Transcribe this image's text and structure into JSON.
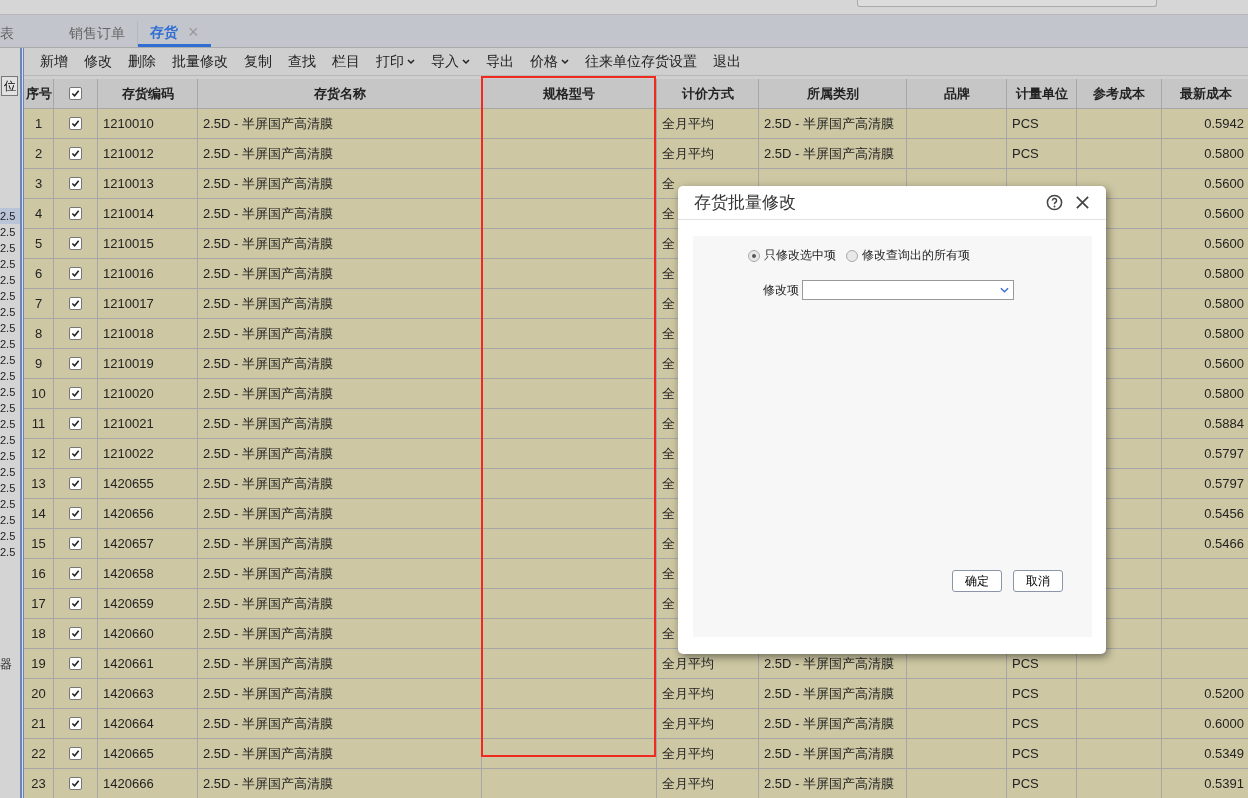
{
  "tabs": [
    {
      "label": "表",
      "selected": false,
      "closable": false
    },
    {
      "label": "销售订单",
      "selected": false,
      "closable": false
    },
    {
      "label": "存货",
      "selected": true,
      "closable": true
    }
  ],
  "close_glyph": "×",
  "left_panel": {
    "button": "位",
    "items": [
      {
        "label": "2.5",
        "selected": true
      },
      {
        "label": "2.5",
        "selected": false
      },
      {
        "label": "2.5",
        "selected": false
      },
      {
        "label": "2.5",
        "selected": false
      },
      {
        "label": "2.5",
        "selected": false
      },
      {
        "label": "2.5",
        "selected": false
      },
      {
        "label": "2.5",
        "selected": false
      },
      {
        "label": "2.5",
        "selected": false
      },
      {
        "label": "2.5",
        "selected": false
      },
      {
        "label": "2.5",
        "selected": false
      },
      {
        "label": "2.5",
        "selected": false
      },
      {
        "label": "2.5",
        "selected": false
      },
      {
        "label": "2.5",
        "selected": false
      },
      {
        "label": "2.5",
        "selected": false
      },
      {
        "label": "2.5",
        "selected": false
      },
      {
        "label": "2.5",
        "selected": false
      },
      {
        "label": "2.5",
        "selected": false
      },
      {
        "label": "2.5",
        "selected": false
      },
      {
        "label": "2.5",
        "selected": false
      },
      {
        "label": "2.5",
        "selected": false
      },
      {
        "label": "2.5",
        "selected": false
      },
      {
        "label": "2.5",
        "selected": false
      }
    ],
    "footer": "器"
  },
  "toolbar": [
    {
      "label": "新增",
      "dropdown": false
    },
    {
      "label": "修改",
      "dropdown": false
    },
    {
      "label": "删除",
      "dropdown": false
    },
    {
      "label": "批量修改",
      "dropdown": false
    },
    {
      "label": "复制",
      "dropdown": false
    },
    {
      "label": "查找",
      "dropdown": false
    },
    {
      "label": "栏目",
      "dropdown": false
    },
    {
      "label": "打印",
      "dropdown": true
    },
    {
      "label": "导入",
      "dropdown": true
    },
    {
      "label": "导出",
      "dropdown": false
    },
    {
      "label": "价格",
      "dropdown": true
    },
    {
      "label": "往来单位存货设置",
      "dropdown": false
    },
    {
      "label": "退出",
      "dropdown": false
    }
  ],
  "table": {
    "columns": [
      "序号",
      "存货编码",
      "存货名称",
      "规格型号",
      "计价方式",
      "所属类别",
      "品牌",
      "计量单位",
      "参考成本",
      "最新成本"
    ],
    "header_checked": true,
    "rows": [
      {
        "no": "1",
        "checked": true,
        "code": "1210010",
        "name": "2.5D - 半屏国产高清膜",
        "pricing": "全月平均",
        "category": "2.5D - 半屏国产高清膜",
        "unit": "PCS",
        "latest": "0.5942"
      },
      {
        "no": "2",
        "checked": true,
        "code": "1210012",
        "name": "2.5D - 半屏国产高清膜",
        "pricing": "全月平均",
        "category": "2.5D - 半屏国产高清膜",
        "unit": "PCS",
        "latest": "0.5800"
      },
      {
        "no": "3",
        "checked": true,
        "code": "1210013",
        "name": "2.5D - 半屏国产高清膜",
        "pricing": "全",
        "latest": "0.5600"
      },
      {
        "no": "4",
        "checked": true,
        "code": "1210014",
        "name": "2.5D - 半屏国产高清膜",
        "pricing": "全",
        "latest": "0.5600"
      },
      {
        "no": "5",
        "checked": true,
        "code": "1210015",
        "name": "2.5D - 半屏国产高清膜",
        "pricing": "全",
        "latest": "0.5600"
      },
      {
        "no": "6",
        "checked": true,
        "code": "1210016",
        "name": "2.5D - 半屏国产高清膜",
        "pricing": "全",
        "latest": "0.5800"
      },
      {
        "no": "7",
        "checked": true,
        "code": "1210017",
        "name": "2.5D - 半屏国产高清膜",
        "pricing": "全",
        "latest": "0.5800"
      },
      {
        "no": "8",
        "checked": true,
        "code": "1210018",
        "name": "2.5D - 半屏国产高清膜",
        "pricing": "全",
        "latest": "0.5800"
      },
      {
        "no": "9",
        "checked": true,
        "code": "1210019",
        "name": "2.5D - 半屏国产高清膜",
        "pricing": "全",
        "latest": "0.5600"
      },
      {
        "no": "10",
        "checked": true,
        "code": "1210020",
        "name": "2.5D - 半屏国产高清膜",
        "pricing": "全",
        "latest": "0.5800"
      },
      {
        "no": "11",
        "checked": true,
        "code": "1210021",
        "name": "2.5D - 半屏国产高清膜",
        "pricing": "全",
        "latest": "0.5884"
      },
      {
        "no": "12",
        "checked": true,
        "code": "1210022",
        "name": "2.5D - 半屏国产高清膜",
        "pricing": "全",
        "latest": "0.5797"
      },
      {
        "no": "13",
        "checked": true,
        "code": "1420655",
        "name": "2.5D - 半屏国产高清膜",
        "pricing": "全",
        "latest": "0.5797"
      },
      {
        "no": "14",
        "checked": true,
        "code": "1420656",
        "name": "2.5D - 半屏国产高清膜",
        "pricing": "全",
        "latest": "0.5456"
      },
      {
        "no": "15",
        "checked": true,
        "code": "1420657",
        "name": "2.5D - 半屏国产高清膜",
        "pricing": "全",
        "latest": "0.5466"
      },
      {
        "no": "16",
        "checked": true,
        "code": "1420658",
        "name": "2.5D - 半屏国产高清膜",
        "pricing": "全"
      },
      {
        "no": "17",
        "checked": true,
        "code": "1420659",
        "name": "2.5D - 半屏国产高清膜",
        "pricing": "全"
      },
      {
        "no": "18",
        "checked": true,
        "code": "1420660",
        "name": "2.5D - 半屏国产高清膜",
        "pricing": "全"
      },
      {
        "no": "19",
        "checked": true,
        "code": "1420661",
        "name": "2.5D - 半屏国产高清膜",
        "pricing": "全月平均",
        "category": "2.5D - 半屏国产高清膜",
        "unit": "PCS"
      },
      {
        "no": "20",
        "checked": true,
        "code": "1420663",
        "name": "2.5D - 半屏国产高清膜",
        "pricing": "全月平均",
        "category": "2.5D - 半屏国产高清膜",
        "unit": "PCS",
        "latest": "0.5200"
      },
      {
        "no": "21",
        "checked": true,
        "code": "1420664",
        "name": "2.5D - 半屏国产高清膜",
        "pricing": "全月平均",
        "category": "2.5D - 半屏国产高清膜",
        "unit": "PCS",
        "latest": "0.6000"
      },
      {
        "no": "22",
        "checked": true,
        "code": "1420665",
        "name": "2.5D - 半屏国产高清膜",
        "pricing": "全月平均",
        "category": "2.5D - 半屏国产高清膜",
        "unit": "PCS",
        "latest": "0.5349"
      },
      {
        "no": "23",
        "checked": true,
        "code": "1420666",
        "name": "2.5D - 半屏国产高清膜",
        "pricing": "全月平均",
        "category": "2.5D - 半屏国产高清膜",
        "unit": "PCS",
        "latest": "0.5391"
      }
    ]
  },
  "dialog": {
    "title": "存货批量修改",
    "scope_options": [
      {
        "label": "只修改选中项",
        "selected": true
      },
      {
        "label": "修改查询出的所有项",
        "selected": false
      }
    ],
    "field_label": "修改项",
    "buttons": [
      "确定",
      "取消"
    ]
  }
}
